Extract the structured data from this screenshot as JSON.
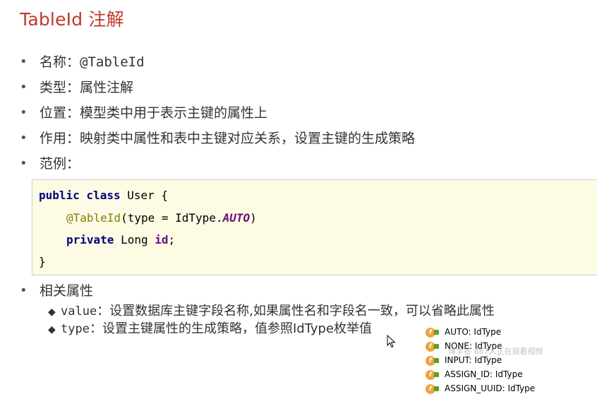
{
  "title": "TableId 注解",
  "bullets": [
    {
      "label": "名称：",
      "value": "@TableId"
    },
    {
      "label": "类型：",
      "value": "属性注解"
    },
    {
      "label": "位置：",
      "value": "模型类中用于表示主键的属性上"
    },
    {
      "label": "作用：",
      "value": "映射类中属性和表中主键对应关系，设置主键的生成策略"
    },
    {
      "label": "范例：",
      "value": ""
    }
  ],
  "code": {
    "line1_kw": "public class",
    "line1_rest": " User {",
    "line2_ann": "@TableId",
    "line2_mid": "(type = IdType.",
    "line2_enum": "AUTO",
    "line2_end": ")",
    "line3_kw": "private",
    "line3_mid": " Long ",
    "line3_field": "id",
    "line3_end": ";",
    "line4": "}"
  },
  "related": {
    "label": "相关属性",
    "items": [
      {
        "key": "value",
        "desc": "：设置数据库主键字段名称,如果属性名和字段名一致，可以省略此属性"
      },
      {
        "key": "type",
        "desc": "：设置主键属性的生成策略，值参照IdType枚举值"
      }
    ]
  },
  "autocomplete": {
    "items": [
      "AUTO: IdType",
      "NONE: IdType",
      "INPUT: IdType",
      "ASSIGN_ID: IdType",
      "ASSIGN_UUID: IdType"
    ]
  },
  "watermark": "博学谷 887人正在观看视频"
}
